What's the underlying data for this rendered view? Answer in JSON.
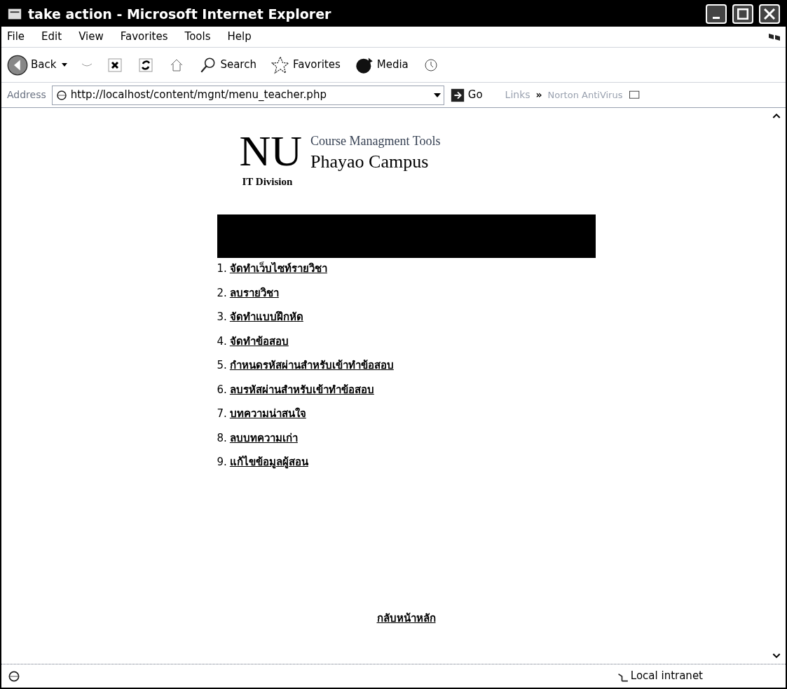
{
  "window": {
    "title": "take action - Microsoft Internet Explorer"
  },
  "menu": [
    "File",
    "Edit",
    "View",
    "Favorites",
    "Tools",
    "Help"
  ],
  "toolbar": [
    {
      "kind": "back",
      "label": "Back"
    },
    {
      "kind": "search",
      "label": "Search"
    },
    {
      "kind": "favorites",
      "label": "Favorites"
    },
    {
      "kind": "media",
      "label": "Media"
    }
  ],
  "address_bar": {
    "label": "Address",
    "value": "http://localhost/content/mgnt/menu_teacher.php",
    "go": "Go",
    "links": "Links",
    "chevron": "»",
    "norton": "Norton AntiVirus"
  },
  "page": {
    "logo": "NU",
    "subtitle": "Course Managment Tools",
    "campus": "Phayao Campus",
    "division": "IT Division",
    "menu_items": [
      {
        "number": "1.",
        "label": "จัดทำเว็บไซท์รายวิชา"
      },
      {
        "number": "2.",
        "label": "ลบรายวิชา"
      },
      {
        "number": "3.",
        "label": "จัดทำแบบฝึกหัด"
      },
      {
        "number": "4.",
        "label": "จัดทำข้อสอบ"
      },
      {
        "number": "5.",
        "label": "กำหนดรหัสผ่านสำหรับเข้าทำข้อสอบ"
      },
      {
        "number": "6.",
        "label": "ลบรหัสผ่านสำหรับเข้าทำข้อสอบ"
      },
      {
        "number": "7.",
        "label": "บทความน่าสนใจ"
      },
      {
        "number": "8.",
        "label": "ลบบทความเก่า"
      },
      {
        "number": "9.",
        "label": "แก้ไขข้อมูลผู้สอน"
      }
    ],
    "back_link": "กลับหน้าหลัก"
  },
  "status_bar": {
    "zone": "Local intranet"
  }
}
